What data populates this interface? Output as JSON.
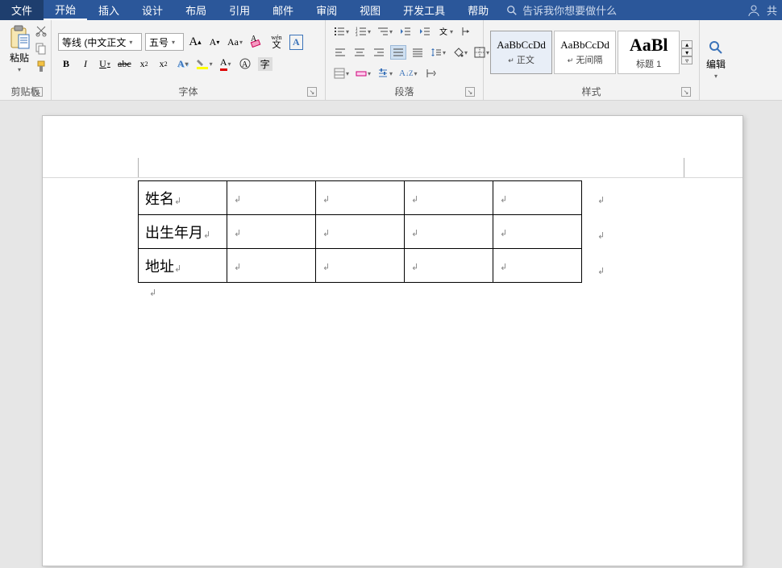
{
  "tabs": {
    "file": "文件",
    "home": "开始",
    "insert": "插入",
    "design": "设计",
    "layout": "布局",
    "references": "引用",
    "mail": "邮件",
    "review": "审阅",
    "view": "视图",
    "devtools": "开发工具",
    "help": "帮助",
    "search_placeholder": "告诉我你想要做什么",
    "share": "共"
  },
  "ribbon": {
    "clipboard": {
      "paste": "粘贴",
      "label": "剪贴板"
    },
    "font": {
      "family": "等线 (中文正文",
      "size": "五号",
      "label": "字体",
      "wen": "wén",
      "wen2": "文"
    },
    "paragraph": {
      "label": "段落"
    },
    "styles": {
      "label": "样式",
      "s1": {
        "preview": "AaBbCcDd",
        "name": "正文"
      },
      "s2": {
        "preview": "AaBbCcDd",
        "name": "无间隔"
      },
      "s3": {
        "preview": "AaBl",
        "name": "标题 1"
      }
    },
    "editing": {
      "label": "编辑"
    }
  },
  "document": {
    "table": {
      "r1c1": "姓名",
      "r2c1": "出生年月",
      "r3c1": "地址"
    }
  }
}
